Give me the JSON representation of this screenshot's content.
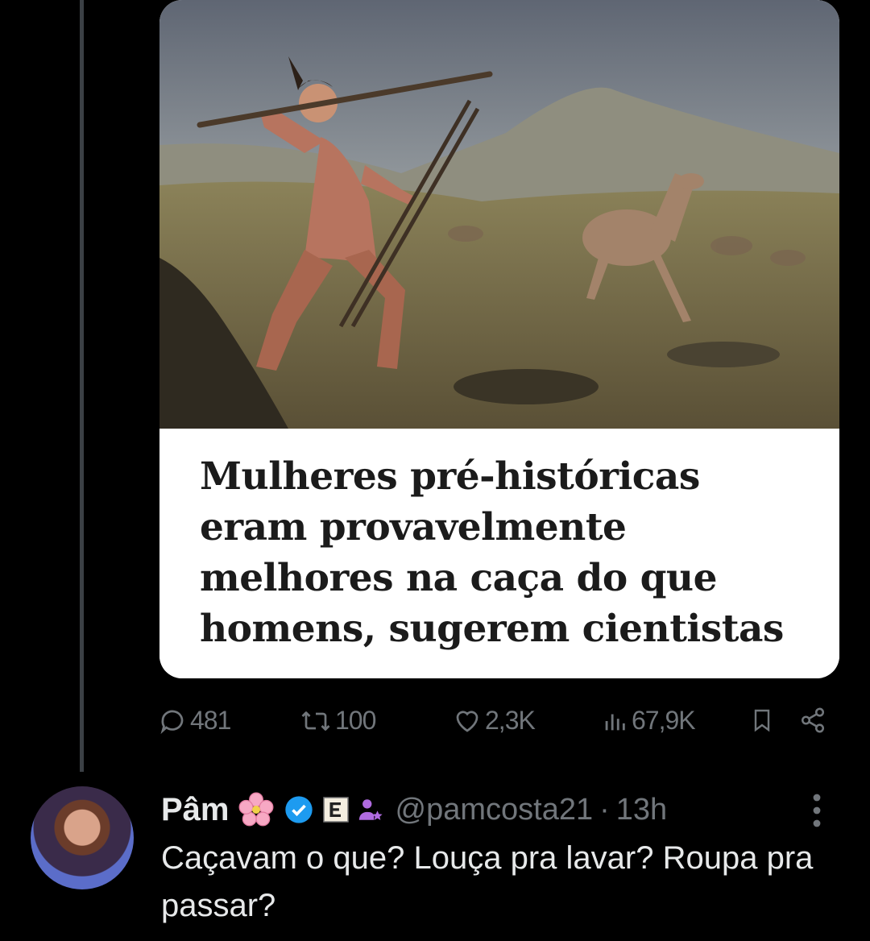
{
  "article_card": {
    "headline": "Mulheres pré-históricas eram provavelmente melhores na caça do que homens, sugerem cientistas"
  },
  "actions": {
    "replies": "481",
    "reposts": "100",
    "likes": "2,3K",
    "views": "67,9K"
  },
  "reply": {
    "display_name": "Pâm",
    "handle": "@pamcosta21",
    "separator": "·",
    "time": "13h",
    "text": "Caçavam o que? Louça pra lavar? Roupa pra passar?"
  },
  "icons": [
    "reply-icon",
    "repost-icon",
    "like-icon",
    "views-icon",
    "bookmark-icon",
    "share-icon",
    "cherry-blossom-icon",
    "verified-badge-icon",
    "affiliate-badge-icon",
    "person-star-icon",
    "more-icon"
  ],
  "colors": {
    "background": "#000000",
    "muted": "#71767b",
    "text": "#e7e9ea",
    "verified": "#1d9bf0",
    "card_bg": "#ffffff"
  }
}
